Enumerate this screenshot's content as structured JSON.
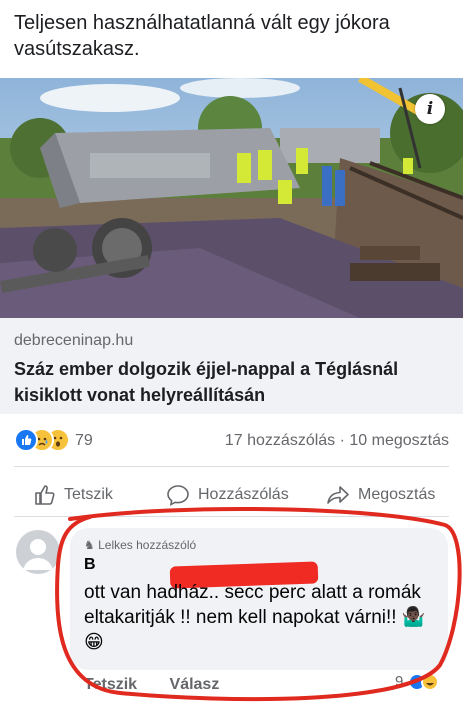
{
  "post": {
    "text": "Teljesen használhatatlanná vált egy jókora vasútszakasz."
  },
  "link_preview": {
    "domain": "debreceninap.hu",
    "title": "Száz ember dolgozik éjjel-nappal a Téglásnál kisiklott vonat helyreállításán",
    "info_icon": "i"
  },
  "stats": {
    "reaction_count": "79",
    "comments_shares": "17 hozzászólás · 10 megosztás",
    "reaction_icons": [
      "like-icon",
      "sad-icon",
      "wow-icon"
    ]
  },
  "actions": {
    "like": "Tetszik",
    "comment": "Hozzászólás",
    "share": "Megosztás"
  },
  "comment": {
    "badge": "Lelkes hozzászóló",
    "author": "B",
    "text": "ott van hadház.. secc perc alatt a romák eltakaritják !! nem kell napokat várni!! 🤷🏿‍♂️😁",
    "like": "Tetszik",
    "reply": "Válasz",
    "reaction_count": "9"
  },
  "colors": {
    "accent_blue": "#1877f2",
    "annotation_red": "#e02a1f",
    "muted": "#65676b"
  }
}
